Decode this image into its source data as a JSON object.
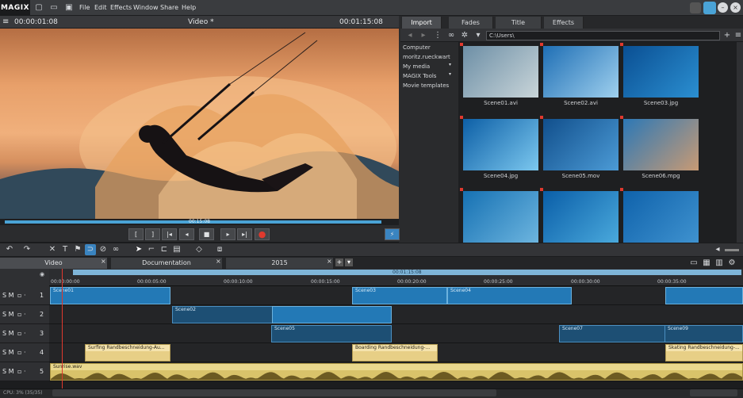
{
  "app": {
    "logo": "MAGIX"
  },
  "menu": [
    "File",
    "Edit",
    "Effects",
    "Window",
    "Share",
    "Help"
  ],
  "preview": {
    "timecode_left": "00:00:01:08",
    "title": "Video *",
    "timecode_right": "00:01:15:08",
    "scrub_time": "00:15:08",
    "progress": 0.97
  },
  "media_pool": {
    "tabs": [
      "Import",
      "Fades",
      "Title",
      "Effects"
    ],
    "active_tab": "Import",
    "path": "C:\\Users\\",
    "tree": [
      "Computer",
      "moritz.rueckwart",
      "My media",
      "MAGIX Tools",
      "Movie templates"
    ],
    "thumbnails": [
      {
        "label": "Scene01.avi",
        "color_a": "#6d8fa6",
        "color_b": "#c9d5d9"
      },
      {
        "label": "Scene02.avi",
        "color_a": "#1f6fb5",
        "color_b": "#9fd0ee"
      },
      {
        "label": "Scene03.jpg",
        "color_a": "#0a4f93",
        "color_b": "#2b8fd1"
      },
      {
        "label": "Scene04.jpg",
        "color_a": "#0d5fa6",
        "color_b": "#7cc8ef"
      },
      {
        "label": "Scene05.mov",
        "color_a": "#114f8c",
        "color_b": "#4c9bd6"
      },
      {
        "label": "Scene06.mpg",
        "color_a": "#2c78b6",
        "color_b": "#c89a74"
      },
      {
        "label": "",
        "color_a": "#1671b3",
        "color_b": "#6db5df"
      },
      {
        "label": "",
        "color_a": "#0a5ea8",
        "color_b": "#4aa9dc"
      },
      {
        "label": "",
        "color_a": "#0f62ab",
        "color_b": "#3f92cf"
      }
    ]
  },
  "timeline": {
    "tabs": [
      "Video",
      "Documentation",
      "2015"
    ],
    "duration_label": "00:01:15:08",
    "ticks": [
      "00:00:00:00",
      "00:00:05:00",
      "00:00:10:00",
      "00:00:15:00",
      "00:00:20:00",
      "00:00:25:00",
      "00:00:30:00",
      "00:00:35:00"
    ],
    "track_prefix": "S M",
    "tracks": [
      "1",
      "2",
      "3",
      "4",
      "5"
    ],
    "clips": {
      "scene01": "Scene01",
      "scene03": "Scene03",
      "scene04": "Scene04",
      "scene02": "Scene02",
      "scene05a": "Scene05",
      "scene05b": "Scene05",
      "scene07": "Scene07",
      "scene09": "Scene09",
      "title1": "Surfing   Randbeschneidung-Au...",
      "title2": "Boarding   Randbeschneidung-...",
      "title3": "Skating   Randbeschneidung-...",
      "audio": "Sunrise.wav"
    }
  },
  "status": {
    "cpu": "CPU: 3% (35/35)"
  },
  "colors": {
    "accent": "#4aa3d6",
    "record": "#e0392e",
    "clip_blue": "#2379b6",
    "title_clip": "#e7cf86"
  }
}
